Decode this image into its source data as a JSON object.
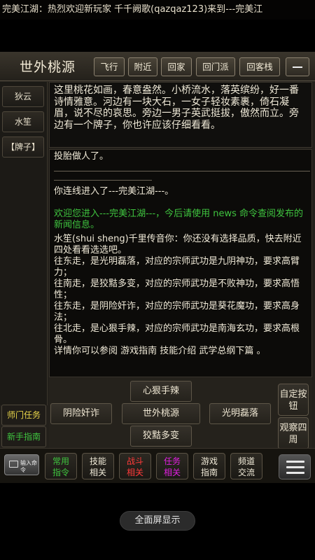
{
  "marquee": "完美江湖：热烈欢迎新玩家 千千阙歌(qazqaz123)来到---完美江",
  "header": {
    "room_name": "世外桃源",
    "buttons": [
      "飞行",
      "附近",
      "回家",
      "回门派",
      "回客栈"
    ]
  },
  "npcs": [
    "狄云",
    "水笙",
    "【牌子】"
  ],
  "description": "这里桃花如画，春意盎然。小桥流水，落英缤纷，好一番诗情雅意。河边有一块大石，一女子轻妆素裹，倚石凝眉，说不尽的哀思。旁边一男子英武挺拔，傲然而立。旁边有一个牌子，你也许应该仔细看看。",
  "log": {
    "line1": "投胎做人了。",
    "line2": "你连线进入了---完美江湖---。",
    "welcome": "欢迎您进入---完美江湖---，今后请使用 news 命令查阅发布的新闻信息。",
    "msg_shui": "水笙(shui sheng)千里传音你：你还没有选择品质，快去附近四处看看选选吧。",
    "hints": [
      "往东走，是光明磊落，对应的宗师武功是九阴神功，要求高臂力；",
      "往南走，是狡黠多变，对应的宗师武功是不败神功，要求高悟性；",
      "往东走，是阴险奸诈，对应的宗师武功是葵花魔功，要求高身法；",
      "往北走，是心狠手辣，对应的宗师武功是南海玄功，要求高根骨。"
    ],
    "guide": "详情你可以参阅 游戏指南 技能介绍 武学总纲下篇 。"
  },
  "directions": {
    "north": "心狠手辣",
    "west": "阴险奸诈",
    "center": "世外桃源",
    "east": "光明磊落",
    "south": "狡黠多变"
  },
  "side_buttons": {
    "custom": "自定按钮",
    "observe": "观察四周"
  },
  "left_buttons": {
    "task": "师门任务",
    "guide": "新手指南"
  },
  "toolbar": {
    "input_label": "输入命令",
    "items": [
      {
        "line1": "常用",
        "line2": "指令",
        "color": "#3fc43f"
      },
      {
        "line1": "技能",
        "line2": "相关",
        "color": "#f0ead8"
      },
      {
        "line1": "战斗",
        "line2": "相关",
        "color": "#ff3a3a"
      },
      {
        "line1": "任务",
        "line2": "相关",
        "color": "#e020e0"
      },
      {
        "line1": "游戏",
        "line2": "指南",
        "color": "#f0ead8"
      },
      {
        "line1": "频道",
        "line2": "交流",
        "color": "#f0ead8"
      }
    ]
  },
  "fullscreen": "全面屏显示",
  "colors": {
    "green": "#3fc43f",
    "blue": "#79b8ff",
    "yellow": "#e8d44a",
    "orange": "#f0a030"
  }
}
